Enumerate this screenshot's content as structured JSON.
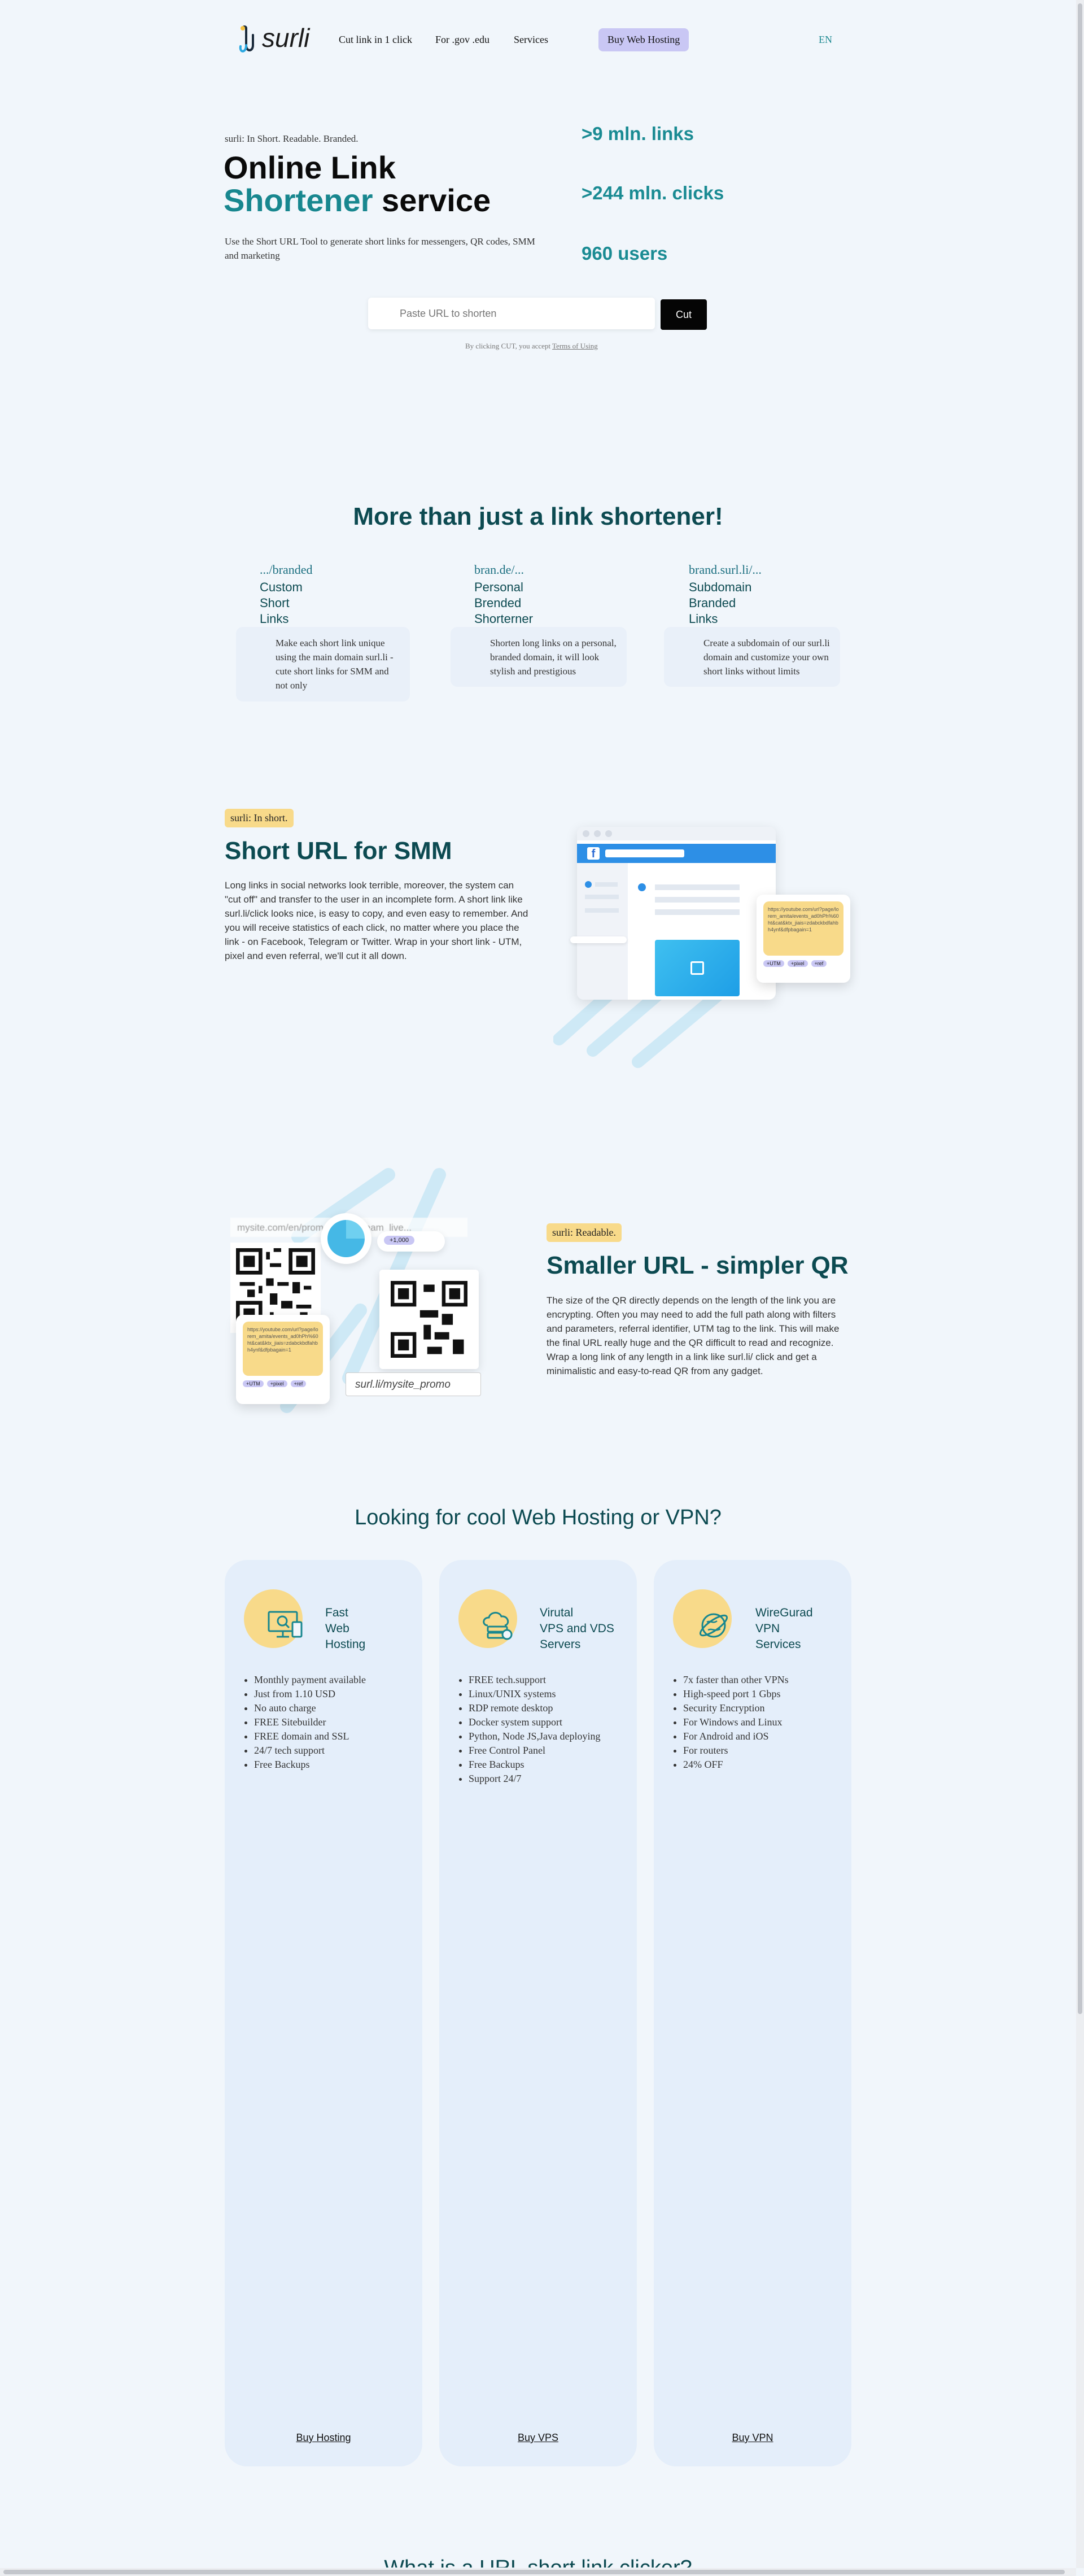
{
  "header": {
    "logo": "surli",
    "nav": [
      "Cut link in 1 click",
      "For .gov .edu",
      "Services"
    ],
    "buy_hosting": "Buy Web Hosting",
    "lang": "EN"
  },
  "hero": {
    "tagline": "surli: In Short. Readable. Branded.",
    "title_line1": "Online Link",
    "title_accent": "Shortener",
    "title_rest": " service",
    "description": "Use the Short URL Tool to generate short links for messengers, QR codes, SMM and marketing",
    "stats": [
      ">9 mln. links",
      ">244 mln. clicks",
      "960 users"
    ],
    "input_placeholder": "Paste URL to shorten",
    "cut_label": "Cut",
    "terms_prefix": "By clicking CUT, you accept ",
    "terms_link": "Terms of Using"
  },
  "features": {
    "heading": "More than just a link shortener!",
    "items": [
      {
        "title": ".../branded",
        "sub": [
          "Custom",
          "Short",
          "Links"
        ],
        "text": "Make each short link unique using the main domain surl.li - cute short links for SMM and not only"
      },
      {
        "title": "bran.de/...",
        "sub": [
          "Personal",
          "Brended",
          "Shorterner"
        ],
        "text": "Shorten long links on a personal, branded domain, it will look stylish and prestigious"
      },
      {
        "title": "brand.surl.li/...",
        "sub": [
          "Subdomain",
          "Branded",
          "Links"
        ],
        "text": "Create a subdomain of our surl.li domain and customize your own short links without limits"
      }
    ]
  },
  "smm": {
    "tag": "surli: In short.",
    "heading": "Short URL for SMM",
    "text": "Long links in social networks look terrible, moreover, the system can \"cut off\" and transfer to the user in an incomplete form. A short link like surl.li/click looks nice, is easy to copy, and even easy to remember. And you will receive statistics of each click, no matter where you place the link - on Facebook, Telegram or Twitter. Wrap in your short link - UTM, pixel and even referral, we'll cut it all down.",
    "long_url": "https://youtube.com/url?page/lorem_amita/events_ad0hPh%60ht&cat&ktx_jiais=zdabckbdfahbh4ynf&dfpbagain=1",
    "chips": [
      "+UTM",
      "+pixel",
      "+ref"
    ]
  },
  "qr": {
    "tag": "surli: Readable.",
    "heading": "Smaller URL - simpler QR",
    "text": "The size of the QR directly depends on the length of the link you are encrypting. Often you may need to add the full path along with filters and parameters, referral identifier, UTM tag to the link. This will make the final URL really huge and the QR difficult to read and recognize. Wrap a long link of any length in a link like surl.li/ click and get a minimalistic and easy-to-read QR from any gadget.",
    "long_url_label": "mysite.com/en/promotional/stream_live...",
    "short_url_label": "surl.li/mysite_promo",
    "counter": "+1,000",
    "long_url": "https://youtube.com/url?page/lorem_amita/events_ad0hPh%60ht&cat&ktx_jiais=zdabckbdfahbh4ynf&dfpbagain=1",
    "chips": [
      "+UTM",
      "+pixel",
      "+ref"
    ]
  },
  "services": {
    "heading": "Looking for cool Web Hosting or VPN?",
    "panels": [
      {
        "title": [
          "Fast",
          "Web",
          "Hosting"
        ],
        "icon": "monitor-icon",
        "items": [
          "Monthly payment available",
          "Just from 1.10 USD",
          "No auto charge",
          "FREE Sitebuilder",
          "FREE domain and SSL",
          "24/7 tech support",
          "Free Backups"
        ],
        "buy": "Buy Hosting"
      },
      {
        "title": [
          "Virutal",
          "VPS and VDS",
          "Servers"
        ],
        "icon": "cloud-server-icon",
        "items": [
          "FREE tech.support",
          "Linux/UNIX systems",
          "RDP remote desktop",
          "Docker system support",
          "Python, Node JS,Java deploying",
          "Free Control Panel",
          "Free Backups",
          "Support 24/7"
        ],
        "buy": "Buy VPS"
      },
      {
        "title": [
          "WireGurad",
          "VPN",
          "Services"
        ],
        "icon": "globe-icon",
        "items": [
          "7x faster than other VPNs",
          "High-speed port 1 Gbps",
          "Security Encryption",
          "For Windows and Linux",
          "For Android and iOS",
          "For routers",
          "24% OFF"
        ],
        "buy": "Buy VPN"
      }
    ]
  },
  "footer": {
    "cut_heading": "What is a URL short link clicker?"
  },
  "colors": {
    "teal": "#18878f",
    "dark_teal": "#0c4a51",
    "yellow": "#f8da8a",
    "lavender": "#c9c7f4",
    "sky": "#2a9be8"
  }
}
